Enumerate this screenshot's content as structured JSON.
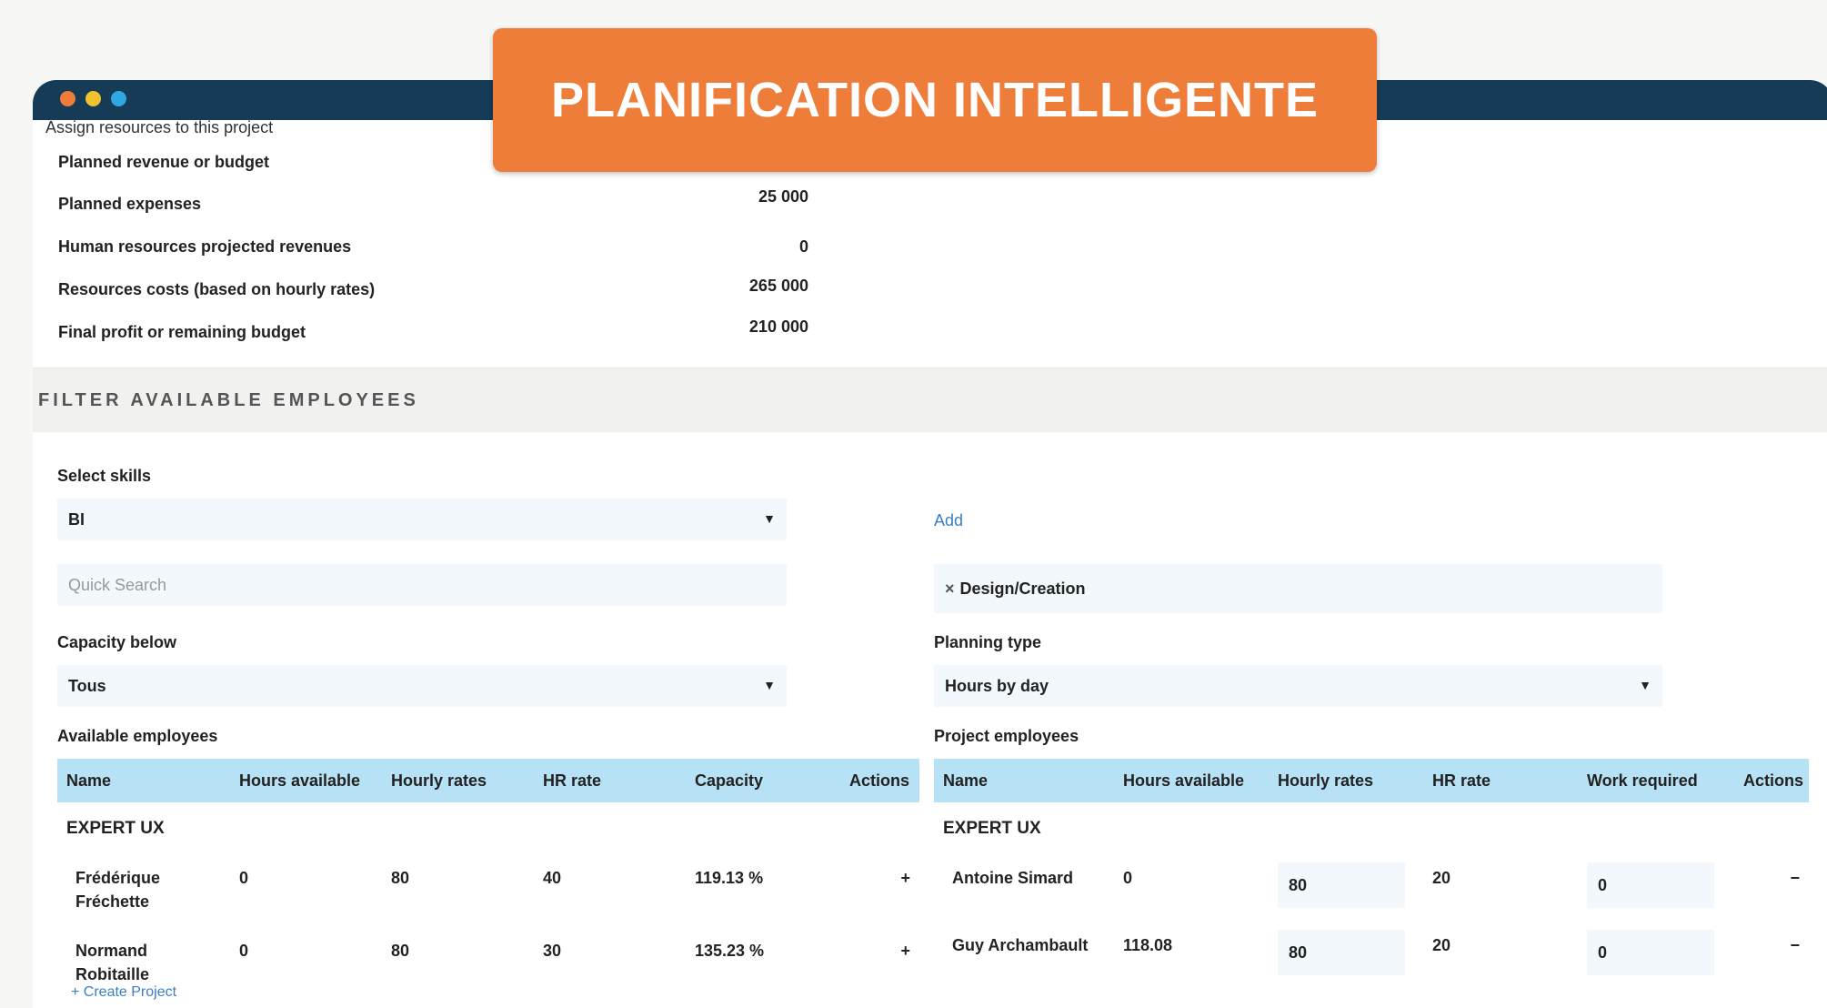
{
  "window": {
    "dot_colors": [
      "#ef7d3a",
      "#f2c12e",
      "#2fa8e0"
    ]
  },
  "banner": {
    "title": "PLANIFICATION INTELLIGENTE"
  },
  "budget": {
    "heading": "Assign resources to this project",
    "rows": [
      {
        "label": "Planned revenue or budget",
        "value": ""
      },
      {
        "label": "Planned expenses",
        "value": "25 000"
      },
      {
        "label": "Human resources projected revenues",
        "value": "0"
      },
      {
        "label": "Resources costs (based on hourly rates)",
        "value": "265 000"
      },
      {
        "label": "Final profit or remaining budget",
        "value": "210 000"
      }
    ]
  },
  "filter": {
    "title": "FILTER AVAILABLE EMPLOYEES",
    "skills_label": "Select skills",
    "skills_value": "BI",
    "add_label": "Add",
    "search_placeholder": "Quick Search",
    "selected_tag": "Design/Creation",
    "capacity_label": "Capacity below",
    "capacity_value": "Tous",
    "planning_label": "Planning type",
    "planning_value": "Hours by day",
    "caret": "▼",
    "tag_remove": "×"
  },
  "available": {
    "title": "Available employees",
    "columns": [
      "Name",
      "Hours available",
      "Hourly rates",
      "HR rate",
      "Capacity",
      "Actions"
    ],
    "group": "EXPERT UX",
    "rows": [
      {
        "name": "Frédérique Fréchette",
        "hours": "0",
        "hourly": "80",
        "hr": "40",
        "capacity": "119.13 %",
        "action": "+"
      },
      {
        "name": "Normand Robitaille",
        "hours": "0",
        "hourly": "80",
        "hr": "30",
        "capacity": "135.23 %",
        "action": "+"
      }
    ],
    "footer_link": "+ Create Project"
  },
  "project": {
    "title": "Project employees",
    "columns": [
      "Name",
      "Hours available",
      "Hourly rates",
      "HR rate",
      "Work required",
      "Actions"
    ],
    "group": "EXPERT UX",
    "rows": [
      {
        "name": "Antoine Simard",
        "hours": "0",
        "hourly": "80",
        "hr": "20",
        "work": "0",
        "action": "−"
      },
      {
        "name": "Guy Archambault",
        "hours": "118.08",
        "hourly": "80",
        "hr": "20",
        "work": "0",
        "action": "−"
      }
    ]
  }
}
